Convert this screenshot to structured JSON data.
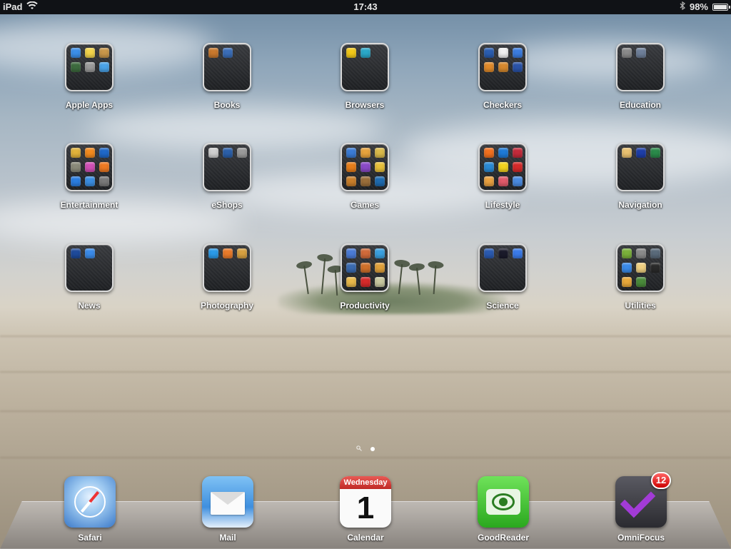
{
  "statusbar": {
    "device": "iPad",
    "time": "17:43",
    "battery": "98%",
    "battery_level": 0.98
  },
  "folders": [
    {
      "label": "Apple Apps",
      "icons": [
        "#3b8ee8",
        "#f2d34a",
        "#c9974a",
        "#3d6b3e",
        "#9a9a9a",
        "#4aa3e8"
      ]
    },
    {
      "label": "Books",
      "icons": [
        "#c8782d",
        "#3a6db8"
      ]
    },
    {
      "label": "Browsers",
      "icons": [
        "#f2c818",
        "#2aa8c9"
      ]
    },
    {
      "label": "Checkers",
      "icons": [
        "#2a5db0",
        "#f0f0f0",
        "#3b7ce0",
        "#e08a2a",
        "#d6892e",
        "#2a53a8"
      ]
    },
    {
      "label": "Education",
      "icons": [
        "#8a8a8a",
        "#6e7f99"
      ]
    },
    {
      "label": "Entertainment",
      "icons": [
        "#e0b23a",
        "#f28a1e",
        "#1f68c8",
        "#8a8a7a",
        "#d04fb5",
        "#f07a22",
        "#2a7de0",
        "#3a8de0",
        "#7a7a7a"
      ]
    },
    {
      "label": "eShops",
      "icons": [
        "#cfcfcf",
        "#2b5fa8",
        "#9a9a9a"
      ]
    },
    {
      "label": "Games",
      "icons": [
        "#3a7bd5",
        "#e6a23c",
        "#d9b94a",
        "#e87e1a",
        "#8a4ac8",
        "#e8c03a",
        "#c87e2a",
        "#9a6e3a",
        "#1e6bb0"
      ]
    },
    {
      "label": "Lifestyle",
      "icons": [
        "#f2701e",
        "#1e7ad6",
        "#c42a3a",
        "#2a8ad6",
        "#f2d21e",
        "#d62a2a",
        "#e8a040",
        "#e05a6a",
        "#4a8ae0"
      ]
    },
    {
      "label": "Navigation",
      "icons": [
        "#e8c070",
        "#1e3ea8",
        "#2a8a4a"
      ]
    },
    {
      "label": "News",
      "icons": [
        "#1e4a9a",
        "#3a8ae8"
      ]
    },
    {
      "label": "Photography",
      "icons": [
        "#2a9ae8",
        "#e87a2a",
        "#d6a040"
      ]
    },
    {
      "label": "Productivity",
      "icons": [
        "#4a7ad6",
        "#d06a3a",
        "#3aa0e0",
        "#3a6ab0",
        "#d0702a",
        "#e0a03a",
        "#e8b84a",
        "#d62a2a",
        "#c8c8a0"
      ]
    },
    {
      "label": "Science",
      "icons": [
        "#2a5ab0",
        "#1a1a2a",
        "#3a7ae8"
      ]
    },
    {
      "label": "Utilities",
      "icons": [
        "#7ab03a",
        "#8a8a8a",
        "#5a6a7a",
        "#3a8ae8",
        "#f0d080",
        "#2a2a2a",
        "#e8a83a",
        "#4a8a3a"
      ]
    }
  ],
  "dock": [
    {
      "label": "Safari"
    },
    {
      "label": "Mail"
    },
    {
      "label": "Calendar",
      "weekday": "Wednesday",
      "day": "1"
    },
    {
      "label": "GoodReader"
    },
    {
      "label": "OmniFocus",
      "badge": "12"
    }
  ],
  "page_indicator": {
    "pages": 1,
    "current": 1
  }
}
